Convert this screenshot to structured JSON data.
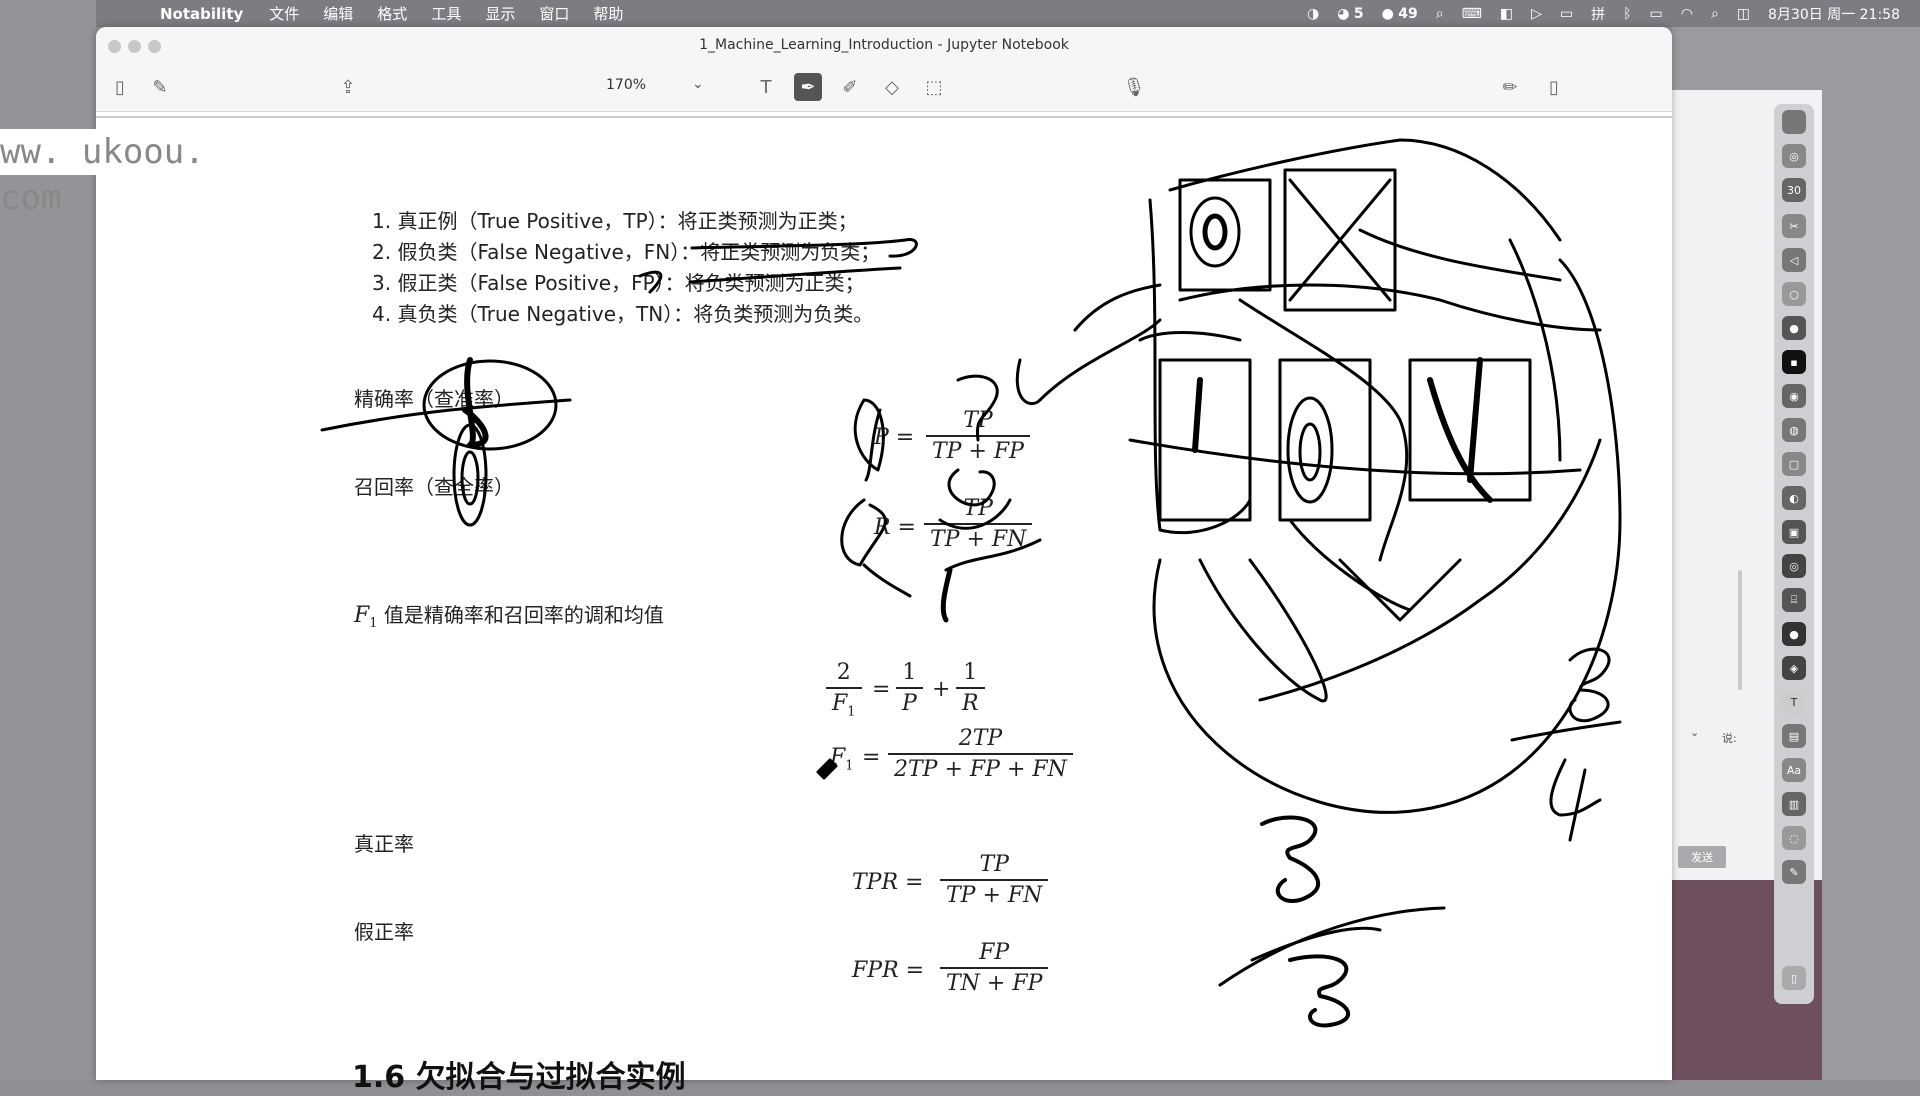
{
  "menubar": {
    "app_name": "Notability",
    "menus": [
      "文件",
      "编辑",
      "格式",
      "工具",
      "显示",
      "窗口",
      "帮助"
    ],
    "wechat_count": "5",
    "battery_count": "49",
    "datetime": "8月30日 周一  21:58"
  },
  "window": {
    "title": "1_Machine_Learning_Introduction - Jupyter Notebook",
    "zoom": "170%"
  },
  "watermark": "ww. ukoou. com",
  "notes": {
    "items": [
      "1. 真正例（True Positive，TP）：将正类预测为正类；",
      "2. 假负类（False Negative，FN）：将正类预测为负类；",
      "3. 假正类（False Positive，FP）：将负类预测为正类；",
      "4. 真负类（True Negative，TN）：将负类预测为负类。"
    ],
    "precision_label": "精确率（查准率）",
    "recall_label": "召回率（查全率）",
    "f1_text": "值是精确率和召回率的调和均值",
    "f1_symbol": "F",
    "f1_sub": "1",
    "tpr_label": "真正率",
    "fpr_label": "假正率",
    "next_heading": "1.6 欠拟合与过拟合实例"
  },
  "formulas": {
    "p_lhs": "P =",
    "p_num": "TP",
    "p_den": "TP + FP",
    "r_lhs": "R =",
    "r_num": "TP",
    "r_den": "TP + FN",
    "f1_eq_num": "2",
    "f1_eq_den": "F",
    "f1_eq_den_sub": "1",
    "f1_eq_mid": "=",
    "f1_p_num": "1",
    "f1_p_den": "P",
    "f1_plus": "+",
    "f1_r_num": "1",
    "f1_r_den": "R",
    "f1_lhs": "F",
    "f1_lhs_sub": "1",
    "f1_eq2": "=",
    "f1_num": "2TP",
    "f1_den": "2TP + FP + FN",
    "tpr_lhs": "TPR =",
    "tpr_num": "TP",
    "tpr_den": "TP + FN",
    "fpr_lhs": "FPR =",
    "fpr_num": "FP",
    "fpr_den": "TN + FP"
  },
  "right_panel": {
    "send": "发送",
    "say": "说:",
    "dock_badge": "30"
  }
}
